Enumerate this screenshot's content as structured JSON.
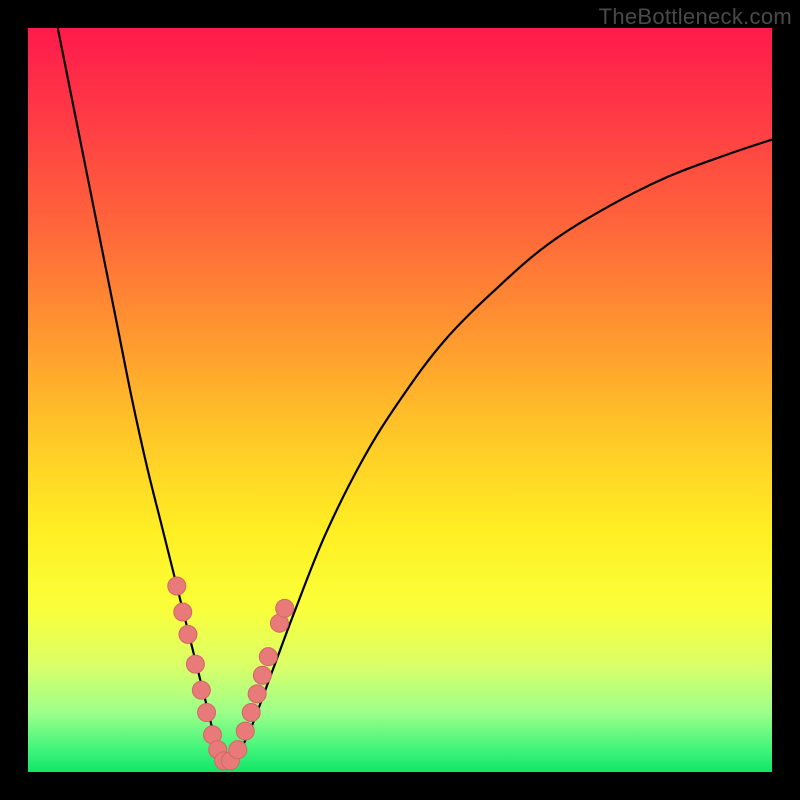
{
  "watermark": "TheBottleneck.com",
  "colors": {
    "curve": "#000000",
    "marker_fill": "#e87a7a",
    "marker_stroke": "#d26666",
    "frame": "#000000"
  },
  "chart_data": {
    "type": "line",
    "title": "",
    "xlabel": "",
    "ylabel": "",
    "xlim": [
      0,
      100
    ],
    "ylim": [
      0,
      100
    ],
    "series": [
      {
        "name": "bottleneck-curve",
        "x": [
          4,
          6,
          8,
          10,
          12,
          14,
          16,
          18,
          20,
          22,
          23,
          24,
          25,
          26,
          27,
          28,
          30,
          33,
          36,
          40,
          45,
          50,
          56,
          63,
          70,
          78,
          86,
          94,
          100
        ],
        "y": [
          100,
          90,
          80,
          70,
          60,
          50,
          41,
          33,
          25,
          17,
          13,
          9,
          5,
          2,
          1,
          2,
          6,
          14,
          22,
          32,
          42,
          50,
          58,
          65,
          71,
          76,
          80,
          83,
          85
        ]
      }
    ],
    "markers": [
      {
        "x": 20.0,
        "y": 25.0
      },
      {
        "x": 20.8,
        "y": 21.5
      },
      {
        "x": 21.5,
        "y": 18.5
      },
      {
        "x": 22.5,
        "y": 14.5
      },
      {
        "x": 23.3,
        "y": 11.0
      },
      {
        "x": 24.0,
        "y": 8.0
      },
      {
        "x": 24.8,
        "y": 5.0
      },
      {
        "x": 25.5,
        "y": 3.0
      },
      {
        "x": 26.3,
        "y": 1.5
      },
      {
        "x": 27.2,
        "y": 1.5
      },
      {
        "x": 28.2,
        "y": 3.0
      },
      {
        "x": 29.2,
        "y": 5.5
      },
      {
        "x": 30.0,
        "y": 8.0
      },
      {
        "x": 30.8,
        "y": 10.5
      },
      {
        "x": 31.5,
        "y": 13.0
      },
      {
        "x": 32.3,
        "y": 15.5
      },
      {
        "x": 33.8,
        "y": 20.0
      },
      {
        "x": 34.5,
        "y": 22.0
      }
    ]
  }
}
